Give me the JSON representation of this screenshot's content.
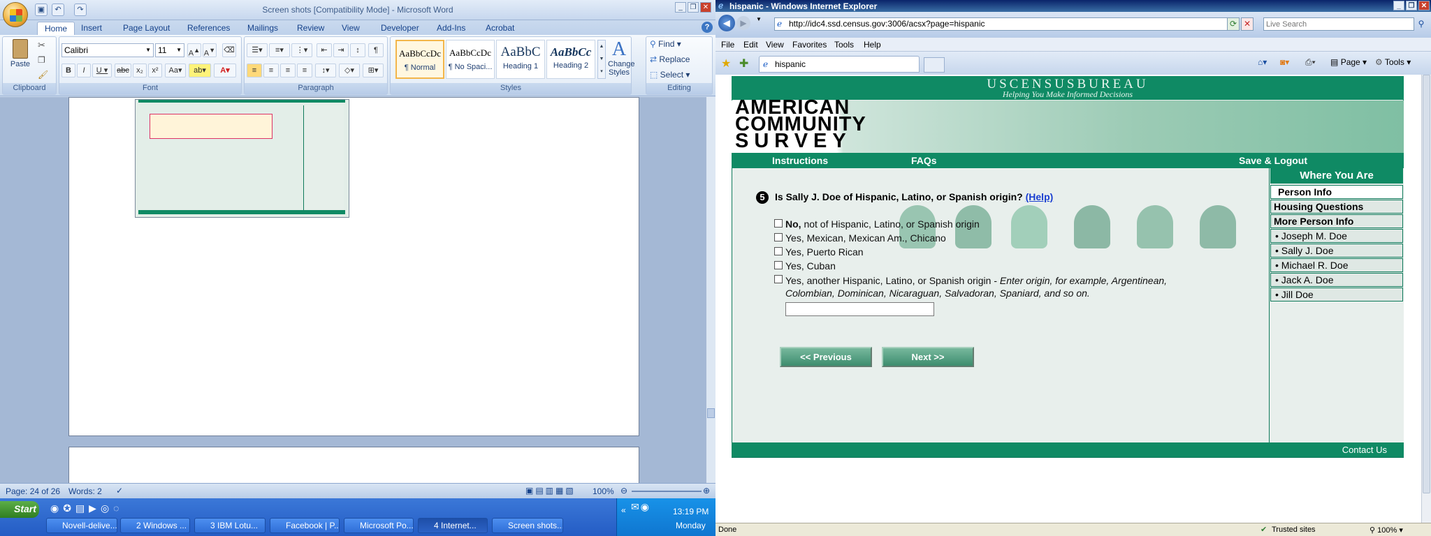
{
  "word": {
    "title": "Screen shots [Compatibility Mode] - Microsoft Word",
    "tabs": [
      "Home",
      "Insert",
      "Page Layout",
      "References",
      "Mailings",
      "Review",
      "View",
      "Developer",
      "Add-Ins",
      "Acrobat"
    ],
    "font_name": "Calibri",
    "font_size": "11",
    "groups": {
      "clipboard": "Clipboard",
      "font": "Font",
      "paragraph": "Paragraph",
      "styles": "Styles",
      "editing": "Editing"
    },
    "paste_label": "Paste",
    "styles": [
      {
        "sample": "AaBbCcDc",
        "name": "¶ Normal"
      },
      {
        "sample": "AaBbCcDc",
        "name": "¶ No Spaci..."
      },
      {
        "sample": "AaBbC",
        "name": "Heading 1"
      },
      {
        "sample": "AaBbCc",
        "name": "Heading 2"
      }
    ],
    "change_styles": "Change Styles",
    "find": "Find",
    "replace": "Replace",
    "select": "Select",
    "status": {
      "page": "Page: 24 of 26",
      "words": "Words: 2",
      "zoom": "100%"
    }
  },
  "ie": {
    "title": "hispanic - Windows Internet Explorer",
    "url": "http://idc4.ssd.census.gov:3006/acsx?page=hispanic",
    "search_placeholder": "Live Search",
    "menu": [
      "File",
      "Edit",
      "View",
      "Favorites",
      "Tools",
      "Help"
    ],
    "tab_title": "hispanic",
    "cmd": {
      "page": "Page",
      "tools": "Tools"
    },
    "status_left": "Done",
    "zone": "Trusted sites",
    "zoom": "100%"
  },
  "census": {
    "bureau": "USCENSUSBUREAU",
    "tagline": "Helping You Make Informed Decisions",
    "acs_lines": [
      "AMERICAN",
      "COMMUNITY",
      "SURVEY"
    ],
    "nav": {
      "instructions": "Instructions",
      "faqs": "FAQs",
      "save": "Save & Logout"
    },
    "question_number": "5",
    "question": "Is Sally J. Doe of Hispanic, Latino, or Spanish origin?",
    "help": "(Help)",
    "options": [
      {
        "bold": "No,",
        "text": " not of Hispanic, Latino, or Spanish origin"
      },
      {
        "bold": "",
        "text": "Yes, Mexican, Mexican Am., Chicano"
      },
      {
        "bold": "",
        "text": "Yes, Puerto Rican"
      },
      {
        "bold": "",
        "text": "Yes, Cuban"
      }
    ],
    "other_option": "Yes, another Hispanic, Latino, or Spanish origin - ",
    "other_hint": "Enter origin, for example, Argentinean, Colombian, Dominican, Nicaraguan, Salvadoran, Spaniard, and so on.",
    "previous": "<<  Previous",
    "next": "Next  >>",
    "sidebar_title": "Where You Are",
    "sidebar_items": [
      "Person Info",
      "Housing Questions",
      "More Person Info",
      "• Joseph M. Doe",
      "• Sally J. Doe",
      "• Michael R. Doe",
      "• Jack A. Doe",
      "• Jill Doe"
    ],
    "contact": "Contact Us"
  },
  "taskbar": {
    "start": "Start",
    "buttons": [
      "Novell-delive...",
      "2 Windows ...",
      "3 IBM Lotu...",
      "Facebook | P...",
      "Microsoft Po...",
      "4 Internet...",
      "Screen shots..."
    ],
    "time": "13:19 PM",
    "day": "Monday"
  }
}
